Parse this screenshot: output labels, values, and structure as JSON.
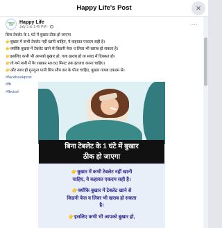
{
  "modal": {
    "title": "Happy Life's Post",
    "close_label": "×"
  },
  "post": {
    "author": "Happy Life",
    "avatar_text": "Happy Life",
    "date": "July 3 at 1:45 PM ·",
    "more_label": "···",
    "lines": [
      "बिना टेबलेट के 1 घंटे में बुखार ठीक हो जाएगा",
      "बुखार में कभी टेबलेट नहीं खानी चाहिए, ये कहावत एकदम सही है।",
      "क्योंकि बुखार में टेबलेट खाने से किडनी फेल व लिवर भी खराब हो सकता है।",
      "इसलिए कभी भी आपको बुखार हो, गला खराब हो या स्वाद में दिक्कत हो।",
      "तो गर्म पानी में पैर रखकर 40-50 मिनट तक इंतजार करना चाहिए।",
      "और साथ ही गुनगुना पानी सिप सीप कर के पीना चाहिए, बुखार गायब एकदम से।"
    ],
    "hashtags": [
      "#facebookpost",
      "#fb",
      "#fbviral"
    ],
    "image_caption_lines": [
      "बिना टेबलेट के 1 घंटे में बुखार",
      "ठीक हो जाएगा"
    ],
    "image_text_blocks": [
      [
        "बुखार में कभी टेबलेट नहीं खानी",
        "चाहिए, ये कहावत एकदम सही है।"
      ],
      [
        "क्योंकि बुखार में टेबलेट खाने से",
        "किडनी फेल व लिवर भी खराब हो सकता",
        "है।"
      ],
      [
        "इसलिए कभी भी आपको बुखार हो,"
      ]
    ]
  },
  "colors": {
    "hashtag": "#385898",
    "image_text": "#2d2a8a",
    "caption_bg": "#111111"
  },
  "icons": {
    "pointing_hand": "👉",
    "globe": "globe-icon",
    "close": "close-icon"
  }
}
